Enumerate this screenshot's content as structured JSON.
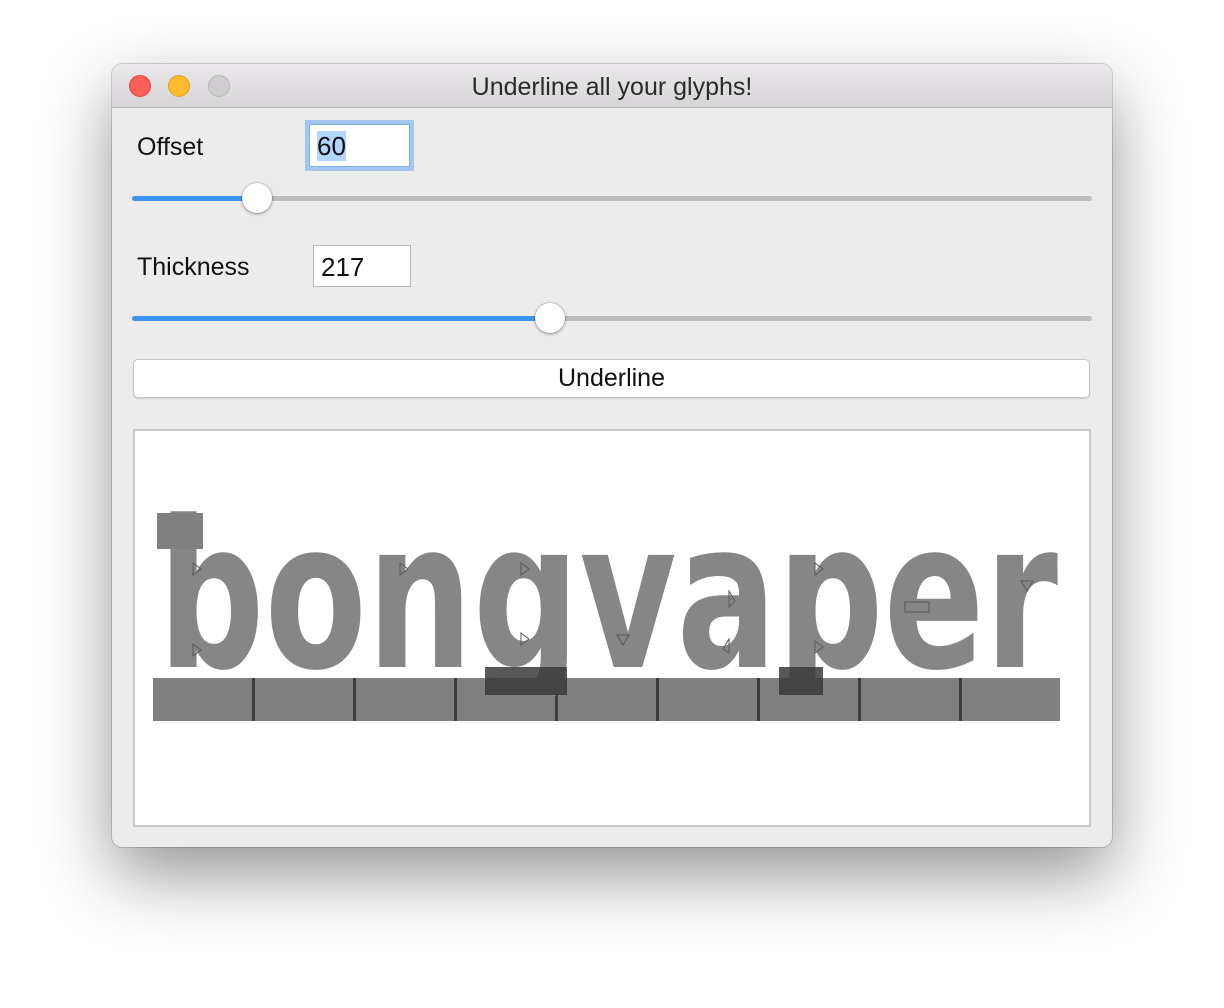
{
  "window": {
    "title": "Underline all your glyphs!"
  },
  "controls": {
    "offset": {
      "label": "Offset",
      "value": "60",
      "slider_fraction": 0.13
    },
    "thickness": {
      "label": "Thickness",
      "value": "217",
      "slider_fraction": 0.435
    },
    "underline_button": "Underline"
  },
  "preview": {
    "glyph_text": "bongvaper",
    "glyph_color": "#808080",
    "underline_color": "#808080"
  },
  "colors": {
    "accent": "#3e95f1",
    "close": "#fc5f57",
    "minimize": "#fdbc2e",
    "zoom_disabled": "#cfcdcf"
  }
}
